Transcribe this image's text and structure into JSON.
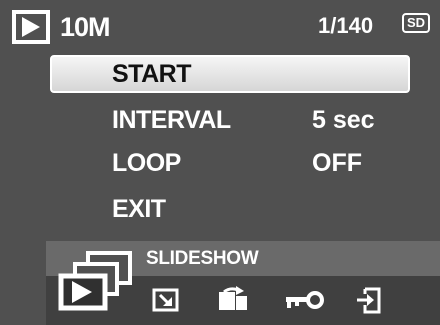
{
  "status": {
    "resolution": "10M",
    "counter": "1/140",
    "card": "SD"
  },
  "menu": {
    "items": [
      {
        "label": "START",
        "value": "",
        "selected": true
      },
      {
        "label": "INTERVAL",
        "value": "5 sec",
        "selected": false
      },
      {
        "label": "LOOP",
        "value": "OFF",
        "selected": false
      },
      {
        "label": "EXIT",
        "value": "",
        "selected": false
      }
    ]
  },
  "mode_bar": {
    "active_mode": "SLIDESHOW",
    "icons": [
      "slideshow-icon",
      "resize-icon",
      "rotate-icon",
      "protect-key-icon",
      "import-icon"
    ]
  },
  "colors": {
    "background": "#505050",
    "band": "#404040",
    "band_header": "#6a6a6a",
    "selection": "#e4e4e4",
    "text": "#ffffff"
  }
}
